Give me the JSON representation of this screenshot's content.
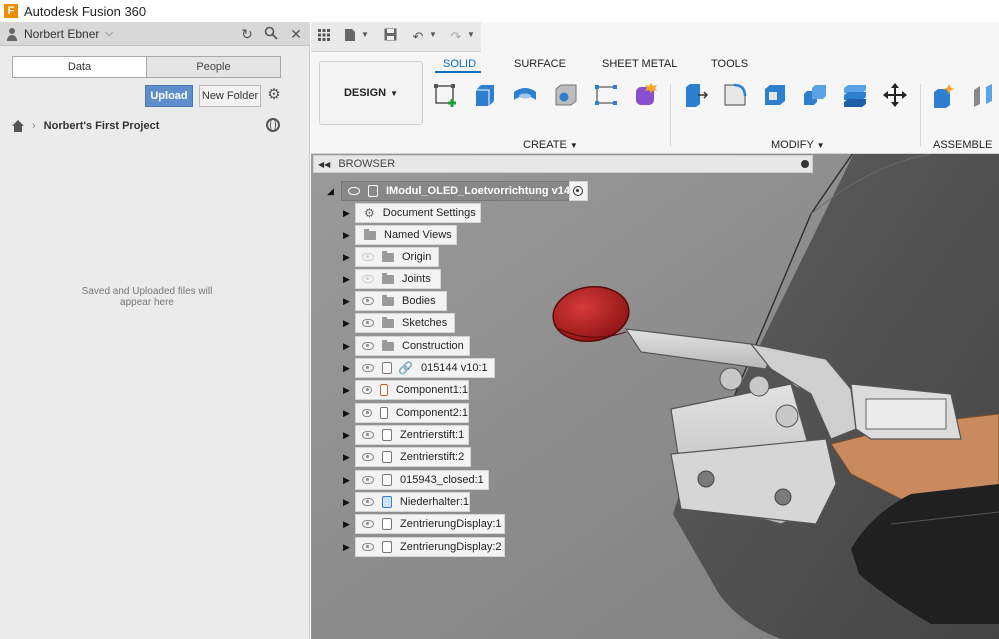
{
  "window": {
    "title": "Autodesk Fusion 360",
    "logo_letter": "F"
  },
  "data_panel": {
    "user_name": "Norbert Ebner",
    "tabs": [
      {
        "label": "Data",
        "active": true
      },
      {
        "label": "People",
        "active": false
      }
    ],
    "upload_label": "Upload",
    "new_folder_label": "New Folder",
    "project_name": "Norbert's First Project",
    "empty_message_line1": "Saved and Uploaded files will",
    "empty_message_line2": "appear here"
  },
  "ribbon": {
    "workspace_label": "DESIGN",
    "tabs": [
      {
        "label": "SOLID",
        "active": true
      },
      {
        "label": "SURFACE",
        "active": false
      },
      {
        "label": "SHEET METAL",
        "active": false
      },
      {
        "label": "TOOLS",
        "active": false
      }
    ],
    "groups": [
      {
        "label": "CREATE"
      },
      {
        "label": "MODIFY"
      },
      {
        "label": "ASSEMBLE"
      }
    ],
    "accent_color": "#0a6fc2"
  },
  "browser": {
    "title": "BROWSER",
    "root": "IModul_OLED_Loetvorrichtung v14",
    "items": [
      {
        "label": "Document Settings"
      },
      {
        "label": "Named Views"
      },
      {
        "label": "Origin"
      },
      {
        "label": "Joints"
      },
      {
        "label": "Bodies"
      },
      {
        "label": "Sketches"
      },
      {
        "label": "Construction"
      },
      {
        "label": "015144 v10:1"
      },
      {
        "label": "Component1:1"
      },
      {
        "label": "Component2:1"
      },
      {
        "label": "Zentrierstift:1"
      },
      {
        "label": "Zentrierstift:2"
      },
      {
        "label": "015943_closed:1"
      },
      {
        "label": "Niederhalter:1"
      },
      {
        "label": "ZentrierungDisplay:1"
      },
      {
        "label": "ZentrierungDisplay:2"
      }
    ]
  },
  "colors": {
    "upload_button": "#5f8fca",
    "handle_red": "#b01e1e",
    "copper_strip": "#c98a5e"
  }
}
